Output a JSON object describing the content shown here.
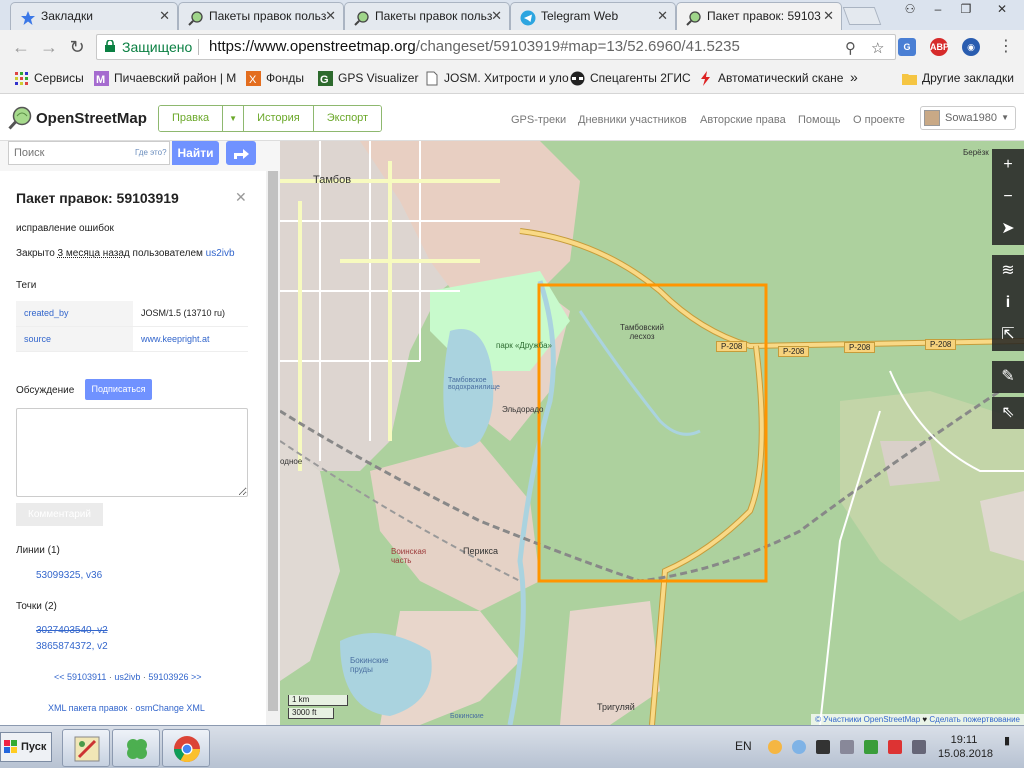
{
  "browser": {
    "tabs": [
      {
        "title": "Закладки",
        "icon": "star-icon"
      },
      {
        "title": "Пакеты правок польз",
        "icon": "osm-icon"
      },
      {
        "title": "Пакеты правок польз",
        "icon": "osm-icon"
      },
      {
        "title": "Telegram Web",
        "icon": "telegram-icon"
      },
      {
        "title": "Пакет правок: 59103",
        "icon": "osm-icon",
        "active": true
      }
    ],
    "secure_label": "Защищено",
    "url_host": "https://www.openstreetmap.org",
    "url_path": "/changeset/59103919#map=13/52.6960/41.5235",
    "bookmarks": [
      {
        "label": "Сервисы",
        "icon": "apps-grid-icon"
      },
      {
        "label": "Пичаевский район | М",
        "icon": "m-icon"
      },
      {
        "label": "Фонды",
        "icon": "x-icon"
      },
      {
        "label": "GPS Visualizer",
        "icon": "g-icon"
      },
      {
        "label": "JOSM. Хитрости и уло",
        "icon": "page-icon"
      },
      {
        "label": "Спецагенты 2ГИС",
        "icon": "spy-icon"
      },
      {
        "label": "Автоматический скане",
        "icon": "bolt-icon"
      }
    ],
    "more_bookmarks": "»",
    "other_bookmarks": "Другие закладки"
  },
  "osm": {
    "brand": "OpenStreetMap",
    "edit_buttons": [
      "Правка",
      "История",
      "Экспорт"
    ],
    "nav_links": [
      "GPS-треки",
      "Дневники участников",
      "Авторские права",
      "Помощь",
      "О проекте"
    ],
    "username": "Sowa1980",
    "search": {
      "placeholder": "Поиск",
      "where": "Где это?",
      "button": "Найти"
    }
  },
  "changeset": {
    "title": "Пакет правок: 59103919",
    "comment": "исправление ошибок",
    "closed_prefix": "Закрыто ",
    "closed_time": "3 месяца назад",
    "closed_mid": " пользователем ",
    "closed_user": "us2ivb",
    "tags_heading": "Теги",
    "tags": [
      {
        "key": "created_by",
        "value": "JOSM/1.5 (13710 ru)",
        "link": false
      },
      {
        "key": "source",
        "value": "www.keepright.at",
        "link": true
      }
    ],
    "discussion_heading": "Обсуждение",
    "subscribe": "Подписаться",
    "comment_button": "Комментарий",
    "ways_heading": "Линии (1)",
    "ways": [
      "53099325, v36"
    ],
    "nodes_heading": "Точки (2)",
    "nodes": [
      "3027403540, v2",
      "3865874372, v2"
    ],
    "nav_prev": "<< 59103911",
    "nav_user": "us2ivb",
    "nav_next": "59103926 >>",
    "dl_xml": "XML пакета правок",
    "dl_osc": "osmChange XML"
  },
  "map": {
    "labels": {
      "tambov": "Тамбов",
      "forestry": "Тамбовский лесхоз",
      "eldorado": "Эльдорадо",
      "reservoir": "Тамбовское водохранилище",
      "park": "парк «Дружба»",
      "voinskaya": "Воинская часть",
      "periksa": "Перикса",
      "lakes": "Бокинские пруды",
      "triguliai": "Тригуляй",
      "berezka": "Берёзк",
      "odnoe": "одное",
      "bokinskie": "Бокинские"
    },
    "road_ref": "Р-208",
    "scale_km": "1 km",
    "scale_ft": "3000 ft",
    "attribution_copy": "© Участники OpenStreetMap",
    "attribution_heart": "♥",
    "attribution_donate": "Сделать пожертвование",
    "bbox_color": "#ff9500"
  },
  "taskbar": {
    "start": "Пуск",
    "lang": "EN",
    "time": "19:11",
    "date": "15.08.2018"
  }
}
